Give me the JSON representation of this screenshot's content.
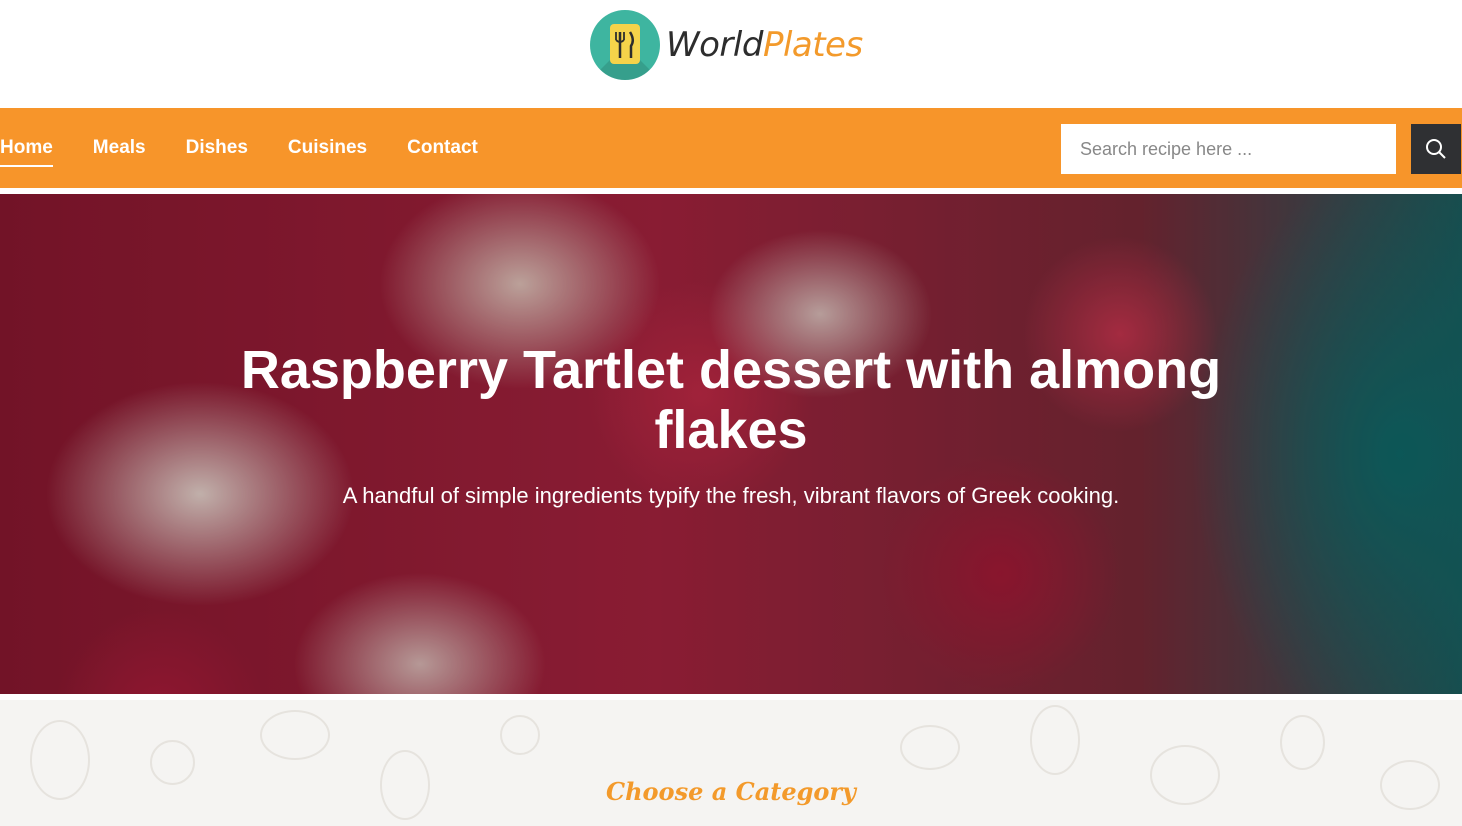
{
  "brand": {
    "name_part1": "World",
    "name_part2": "Plates",
    "accent_color": "#f7952a",
    "dark_color": "#2f3033",
    "teal_color": "#3eb5a0"
  },
  "nav": {
    "items": [
      {
        "label": "Home",
        "active": true
      },
      {
        "label": "Meals",
        "active": false
      },
      {
        "label": "Dishes",
        "active": false
      },
      {
        "label": "Cuisines",
        "active": false
      },
      {
        "label": "Contact",
        "active": false
      }
    ],
    "search": {
      "placeholder": "Search recipe here ...",
      "value": "",
      "button_icon": "search-icon"
    }
  },
  "hero": {
    "title": "Raspberry Tartlet dessert with almong flakes",
    "subtitle": "A handful of simple ingredients typify the fresh, vibrant flavors of Greek cooking."
  },
  "category": {
    "title": "Choose a Category"
  }
}
